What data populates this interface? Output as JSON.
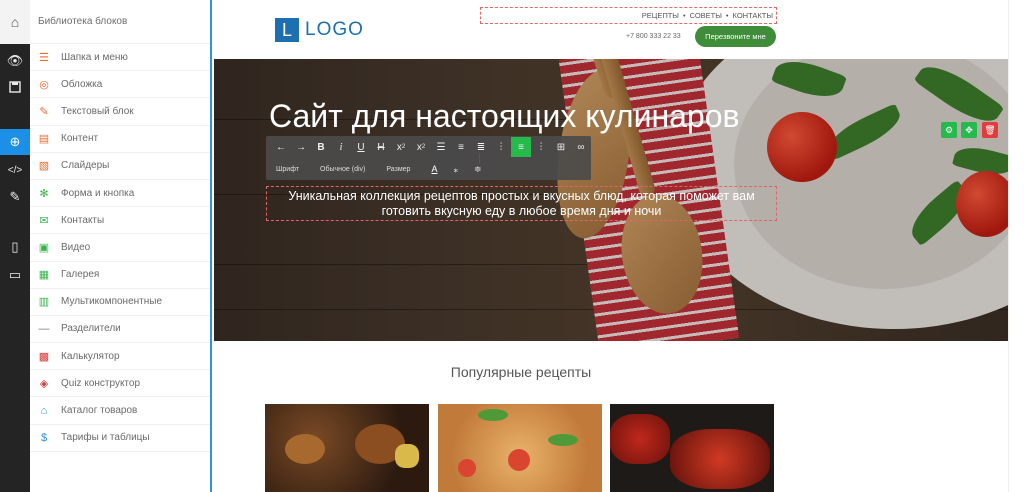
{
  "panel": {
    "title": "Библиотека блоков",
    "items": [
      {
        "label": "Шапка и меню",
        "icon": "menu-icon",
        "color": "#e86b32"
      },
      {
        "label": "Обложка",
        "icon": "target-icon",
        "color": "#e86b32"
      },
      {
        "label": "Текстовый блок",
        "icon": "text-block-icon",
        "color": "#e86b32"
      },
      {
        "label": "Контент",
        "icon": "content-icon",
        "color": "#e86b32"
      },
      {
        "label": "Слайдеры",
        "icon": "slider-icon",
        "color": "#e86b32"
      },
      {
        "label": "Форма и кнопка",
        "icon": "form-icon",
        "color": "#37b24d"
      },
      {
        "label": "Контакты",
        "icon": "mail-icon",
        "color": "#37b24d"
      },
      {
        "label": "Видео",
        "icon": "video-icon",
        "color": "#37b24d"
      },
      {
        "label": "Галерея",
        "icon": "gallery-icon",
        "color": "#37b24d"
      },
      {
        "label": "Мультикомпонентные",
        "icon": "multi-icon",
        "color": "#37b24d"
      },
      {
        "label": "Разделители",
        "icon": "divider-icon",
        "color": "#777777"
      },
      {
        "label": "Калькулятор",
        "icon": "calculator-icon",
        "color": "#d93a3a"
      },
      {
        "label": "Quiz конструктор",
        "icon": "quiz-icon",
        "color": "#d93a3a"
      },
      {
        "label": "Каталог товаров",
        "icon": "basket-icon",
        "color": "#2d94e0"
      },
      {
        "label": "Тарифы и таблицы",
        "icon": "dollar-icon",
        "color": "#2d94e0"
      }
    ]
  },
  "site": {
    "logo_letter": "L",
    "logo_text": "LOGO",
    "nav": [
      "РЕЦЕПТЫ",
      "•",
      "СОВЕТЫ",
      "•",
      "КОНТАКТЫ"
    ],
    "phone": "+7 800 333 22 33",
    "call_button": "Перезвоните мне",
    "hero_title": "Сайт для настоящих кулинаров",
    "hero_subtitle": "Уникальная коллекция рецептов простых и вкусных блюд, которая поможет вам готовить вкусную еду в любое время дня и ночи",
    "section_title": "Популярные рецепты"
  },
  "toolbar": {
    "font_label": "Шрифт",
    "style_label": "Обычное (div)",
    "size_label": "Размер"
  },
  "colors": {
    "accent_blue": "#2d94e0",
    "green": "#3f8c3a",
    "toolbar_active": "#26b94b",
    "delete_red": "#e03c3c"
  }
}
